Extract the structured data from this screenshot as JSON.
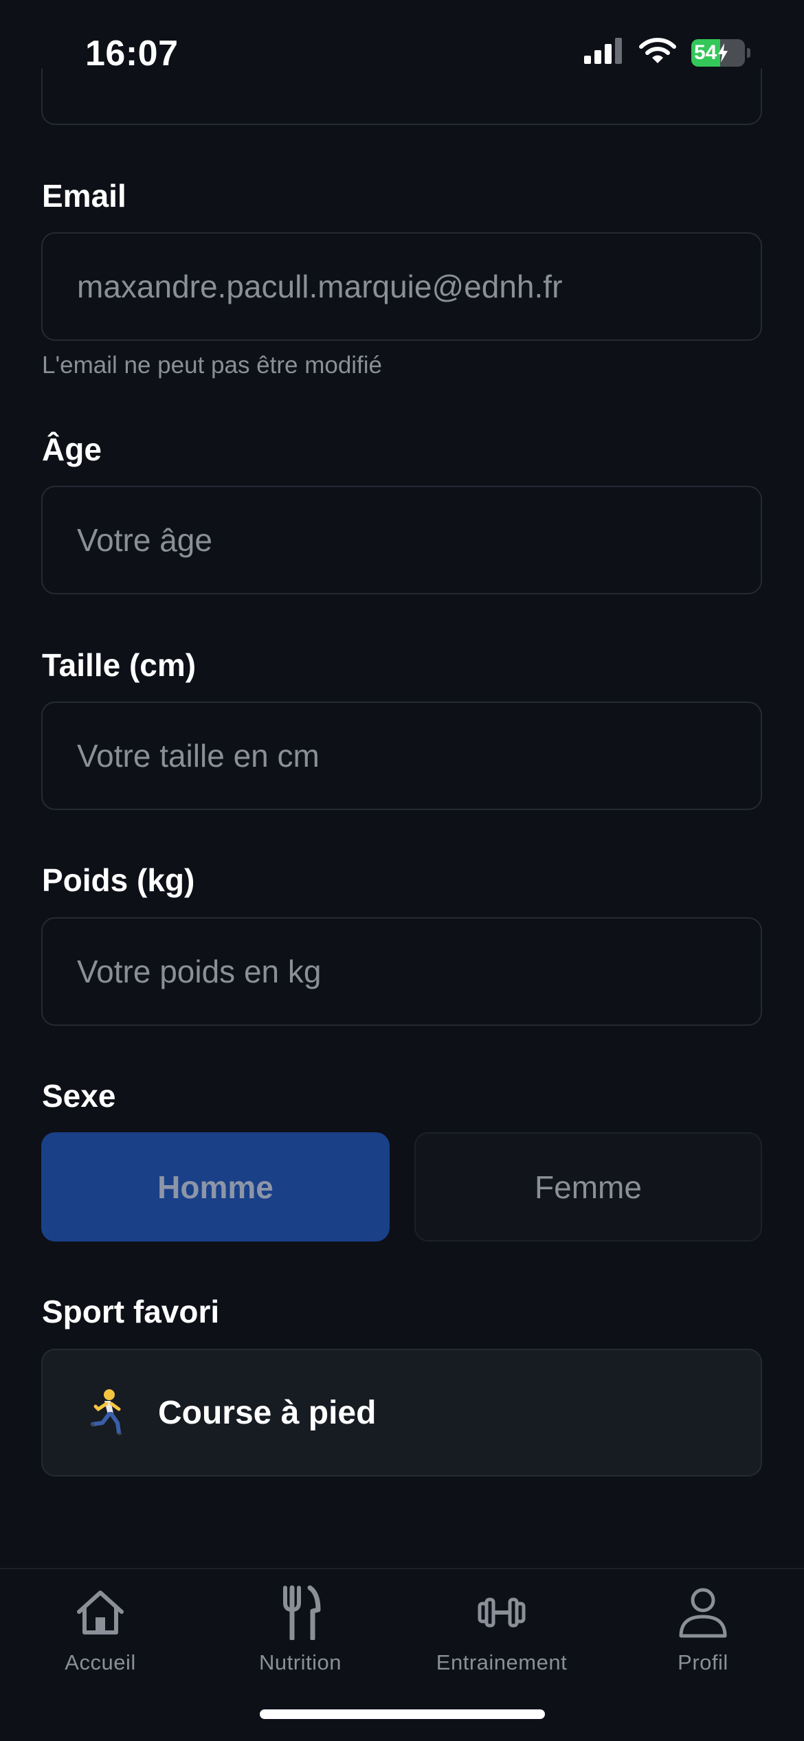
{
  "status_bar": {
    "time": "16:07",
    "battery": "54"
  },
  "form": {
    "email": {
      "label": "Email",
      "value": "maxandre.pacull.marquie@ednh.fr",
      "helper": "L'email ne peut pas être modifié"
    },
    "age": {
      "label": "Âge",
      "placeholder": "Votre âge"
    },
    "height": {
      "label": "Taille (cm)",
      "placeholder": "Votre taille en cm"
    },
    "weight": {
      "label": "Poids (kg)",
      "placeholder": "Votre poids en kg"
    },
    "sex": {
      "label": "Sexe",
      "options": [
        "Homme",
        "Femme"
      ],
      "selected": "Homme"
    },
    "sport": {
      "label": "Sport favori",
      "value": "Course à pied",
      "icon": "runner-icon"
    }
  },
  "tab_bar": {
    "items": [
      {
        "label": "Accueil",
        "icon": "home-icon"
      },
      {
        "label": "Nutrition",
        "icon": "fork-knife-icon"
      },
      {
        "label": "Entrainement",
        "icon": "dumbbell-icon"
      },
      {
        "label": "Profil",
        "icon": "person-icon"
      }
    ]
  },
  "colors": {
    "background": "#0d1017",
    "selected": "#1a4088",
    "muted_text": "#8a8f98",
    "battery": "#34c759"
  }
}
